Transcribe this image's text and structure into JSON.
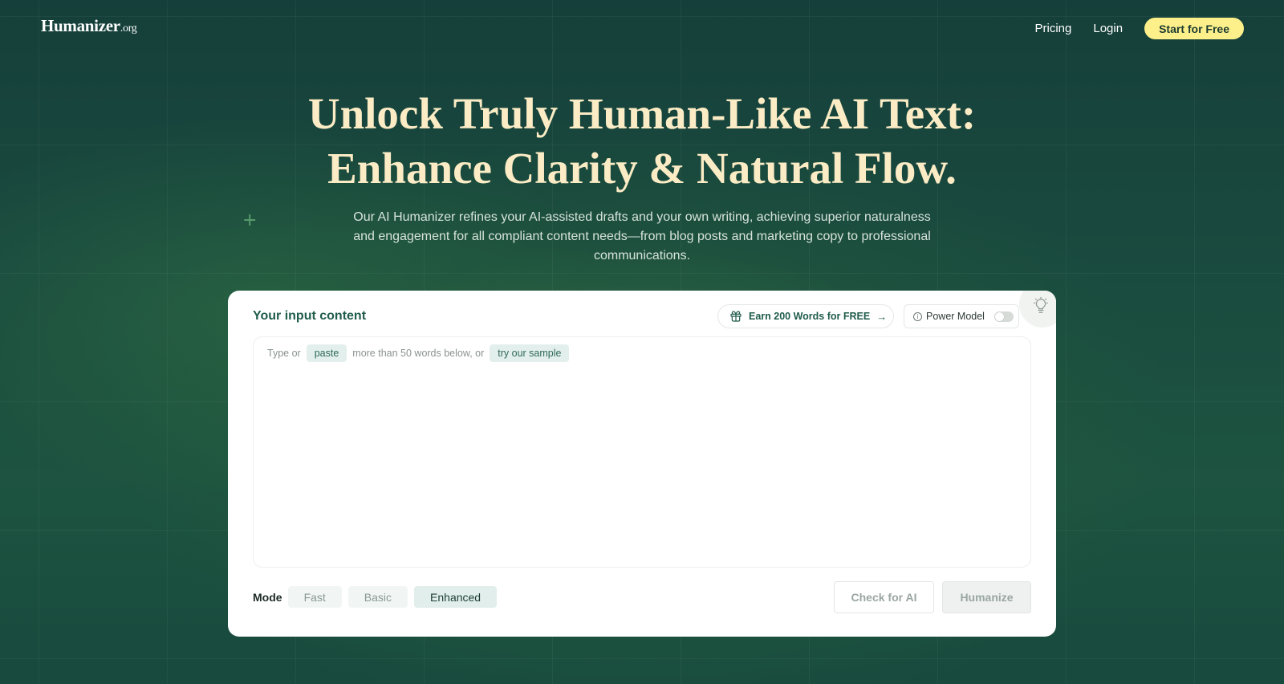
{
  "header": {
    "logo_main": "Humanizer",
    "logo_tld": ".org",
    "nav": {
      "pricing": "Pricing",
      "login": "Login",
      "cta": "Start for Free"
    }
  },
  "hero": {
    "title_line1": "Unlock Truly Human-Like AI Text:",
    "title_line2": "Enhance Clarity & Natural Flow.",
    "subtitle_line1": "Our AI Humanizer refines your AI-assisted drafts and your own writing, achieving superior naturalness",
    "subtitle_line2": "and engagement for all compliant content needs—from blog posts and marketing copy to professional",
    "subtitle_line3": "communications."
  },
  "card": {
    "label": "Your input content",
    "earn": "Earn 200 Words for FREE",
    "earn_arrow": "→",
    "power_model": "Power Model",
    "power_model_on": false,
    "placeholder": {
      "part1": "Type or",
      "paste": "paste",
      "part2": "more than 50 words below, or",
      "sample": "try our sample"
    },
    "mode": {
      "label": "Mode",
      "options": [
        "Fast",
        "Basic",
        "Enhanced"
      ],
      "selected": "Enhanced"
    },
    "check_button": "Check for AI",
    "humanize_button": "Humanize"
  },
  "colors": {
    "accent_yellow": "#fdf08a",
    "title_cream": "#fbecc5",
    "brand_green": "#1f5c4a"
  }
}
